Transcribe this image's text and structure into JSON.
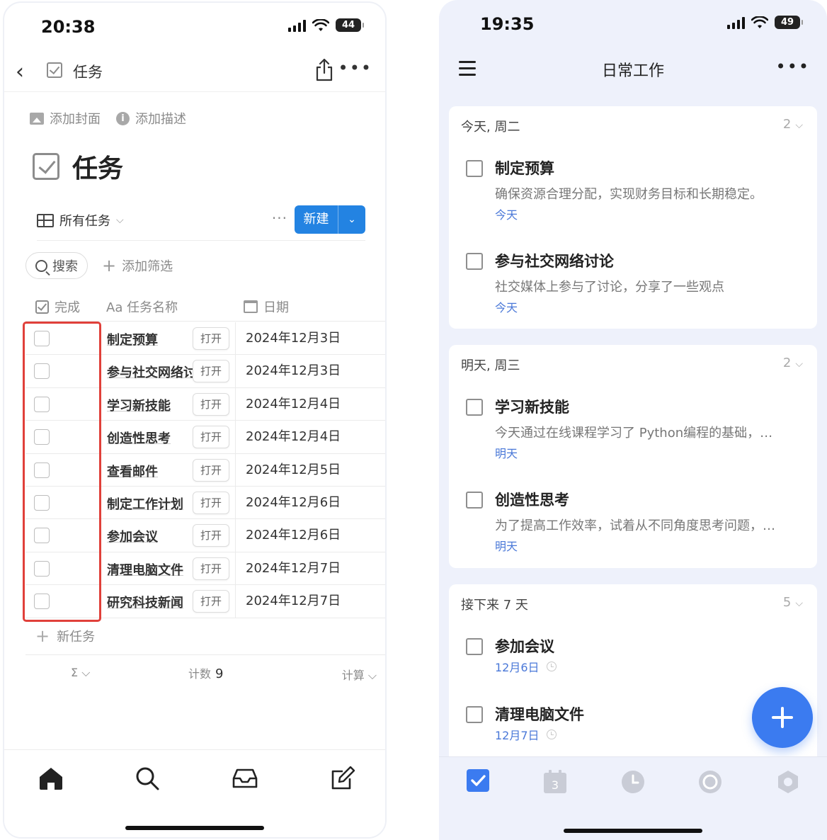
{
  "left": {
    "status": {
      "time": "20:38",
      "battery": "44"
    },
    "nav": {
      "back": "‹",
      "title": "任务"
    },
    "cover": {
      "add_cover": "添加封面",
      "add_desc": "添加描述"
    },
    "page_title": "任务",
    "view": {
      "name": "所有任务",
      "chevron": "⌵",
      "dots": "···",
      "new_label": "新建",
      "new_dd": "⌄"
    },
    "filter": {
      "search": "搜索",
      "add_filter": "添加筛选",
      "plus": "+"
    },
    "columns": {
      "done": "完成",
      "name": "Aa 任务名称",
      "date": "日期"
    },
    "open_label": "打开",
    "rows": [
      {
        "name": "制定预算",
        "date": "2024年12月3日"
      },
      {
        "name": "参与社交网络讨论",
        "date": "2024年12月3日"
      },
      {
        "name": "学习新技能",
        "date": "2024年12月4日"
      },
      {
        "name": "创造性思考",
        "date": "2024年12月4日"
      },
      {
        "name": "查看邮件",
        "date": "2024年12月5日"
      },
      {
        "name": "制定工作计划",
        "date": "2024年12月6日"
      },
      {
        "name": "参加会议",
        "date": "2024年12月6日"
      },
      {
        "name": "清理电脑文件",
        "date": "2024年12月7日"
      },
      {
        "name": "研究科技新闻",
        "date": "2024年12月7日"
      }
    ],
    "new_task": "新任务",
    "summary": {
      "sigma": "Σ ⌵",
      "count_label": "计数",
      "count": "9",
      "calc": "计算 ⌵"
    }
  },
  "right": {
    "status": {
      "time": "19:35",
      "battery": "49"
    },
    "nav": {
      "title": "日常工作",
      "more": "•••"
    },
    "sections": [
      {
        "header": "今天, 周二",
        "count": "2",
        "chevron": "⌵",
        "tasks": [
          {
            "title": "制定预算",
            "desc": "确保资源合理分配，实现财务目标和长期稳定。",
            "due": "今天"
          },
          {
            "title": "参与社交网络讨论",
            "desc": "社交媒体上参与了讨论，分享了一些观点",
            "due": "今天"
          }
        ]
      },
      {
        "header": "明天, 周三",
        "count": "2",
        "chevron": "⌵",
        "tasks": [
          {
            "title": "学习新技能",
            "desc": "今天通过在线课程学习了 Python编程的基础，…",
            "due": "明天"
          },
          {
            "title": "创造性思考",
            "desc": "为了提高工作效率，试着从不同角度思考问题，…",
            "due": "明天"
          }
        ]
      },
      {
        "header": "接下来 7 天",
        "count": "5",
        "chevron": "⌵",
        "tasks": [
          {
            "title": "参加会议",
            "due": "12月6日"
          },
          {
            "title": "清理电脑文件",
            "due": "12月7日"
          }
        ]
      }
    ],
    "calendar_tab_day": "3"
  },
  "colors": {
    "accent_left": "#2383e2",
    "accent_right": "#3b7bf0",
    "highlight": "#e0403a",
    "date_blue": "#4a78d8"
  }
}
